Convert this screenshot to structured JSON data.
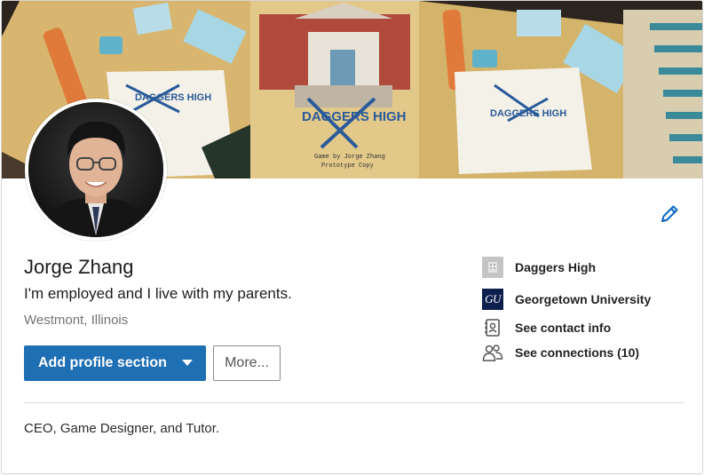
{
  "profile": {
    "name": "Jorge Zhang",
    "headline": "I'm employed and I live with my parents.",
    "location": "Westmont, Illinois",
    "summary": "CEO, Game Designer, and Tutor."
  },
  "banner": {
    "book_title": "DAGGERS HIGH",
    "book_subtitle": "Game by Jorge Zhang",
    "book_tagline": "Prototype Copy",
    "card_title_left": "DAGGERS HIGH",
    "card_title_right": "DAGGERS HIGH"
  },
  "actions": {
    "add_section_label": "Add profile section",
    "more_label": "More..."
  },
  "sidebar": {
    "company": "Daggers High",
    "school": "Georgetown University",
    "school_logo_text": "GU",
    "contact": "See contact info",
    "connections": "See connections (10)"
  },
  "colors": {
    "primary_button": "#1f6fb5",
    "edit_icon": "#0a66c2",
    "school_logo_bg": "#0d1f4d"
  },
  "icons": [
    "pencil-icon",
    "company-logo",
    "school-logo",
    "contact-card-icon",
    "people-icon",
    "caret-down-icon"
  ]
}
